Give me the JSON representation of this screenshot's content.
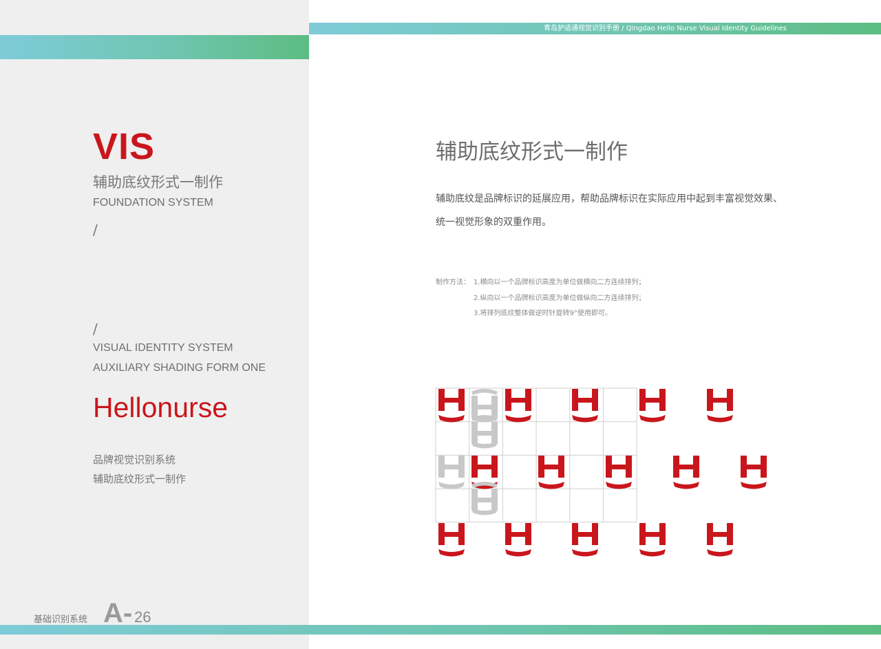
{
  "header": {
    "guideline_title": "青岛护适通视觉识别手册 / Qingdao Hello Nurse Visual Identity Guidelines"
  },
  "left_panel": {
    "vis_title": "VIS",
    "cn_title": "辅助底纹形式一制作",
    "en_title": "FOUNDATION SYSTEM",
    "slash_1": "/",
    "slash_2": "/",
    "vi_en_line_1": "VISUAL IDENTITY SYSTEM",
    "vi_en_line_2": "AUXILIARY SHADING FORM ONE",
    "brand_name": "Hellonurse",
    "brand_sub_1": "品牌视觉识别系统",
    "brand_sub_2": "辅助底纹形式一制作"
  },
  "footer": {
    "section_cn": "基础识别系统",
    "section_letter": "A-",
    "page_number": "26"
  },
  "main": {
    "title": "辅助底纹形式一制作",
    "description_line_1": "辅助底纹是品牌标识的延展应用，帮助品牌标识在实际应用中起到丰富视觉效果、",
    "description_line_2": "统一视觉形象的双重作用。",
    "method_label": "制作方法：",
    "method_steps": [
      "1.横向以一个品牌标识高度为单位做横向二方连续排列；",
      "2.纵向以一个品牌标识高度为单位做纵向二方连续排列；",
      "3.将排列底纹整体做逆时针旋转9°使用即可。"
    ]
  },
  "colors": {
    "brand_red": "#c9161c",
    "ghost_gray": "#c8c8c8",
    "gradient_start": "#7ecbd8",
    "gradient_end": "#5cbd82",
    "left_panel_bg": "#efefef"
  },
  "icons": {
    "logo_mark": "hello-nurse-h-logo-icon"
  }
}
